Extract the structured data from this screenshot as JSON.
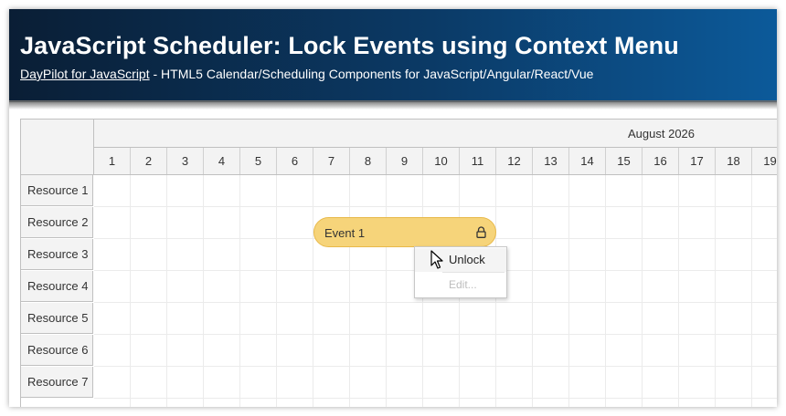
{
  "header": {
    "title": "JavaScript Scheduler: Lock Events using Context Menu",
    "link_text": "DayPilot for JavaScript",
    "tagline": " - HTML5 Calendar/Scheduling Components for JavaScript/Angular/React/Vue"
  },
  "scheduler": {
    "month": "August 2026",
    "days": [
      "1",
      "2",
      "3",
      "4",
      "5",
      "6",
      "7",
      "8",
      "9",
      "10",
      "11",
      "12",
      "13",
      "14",
      "15",
      "16",
      "17",
      "18",
      "19"
    ],
    "resources": [
      "Resource 1",
      "Resource 2",
      "Resource 3",
      "Resource 4",
      "Resource 5",
      "Resource 6",
      "Resource 7"
    ],
    "event": {
      "text": "Event 1",
      "icon": "lock-icon",
      "color": "#f6d47a"
    }
  },
  "context_menu": {
    "items": [
      {
        "label": "Unlock",
        "enabled": true
      },
      {
        "label": "Edit...",
        "enabled": false
      }
    ]
  },
  "colors": {
    "banner_start": "#0a1e35",
    "banner_end": "#0c5a9a",
    "header_bg": "#f3f3f3",
    "event_border": "#e8b94a"
  }
}
